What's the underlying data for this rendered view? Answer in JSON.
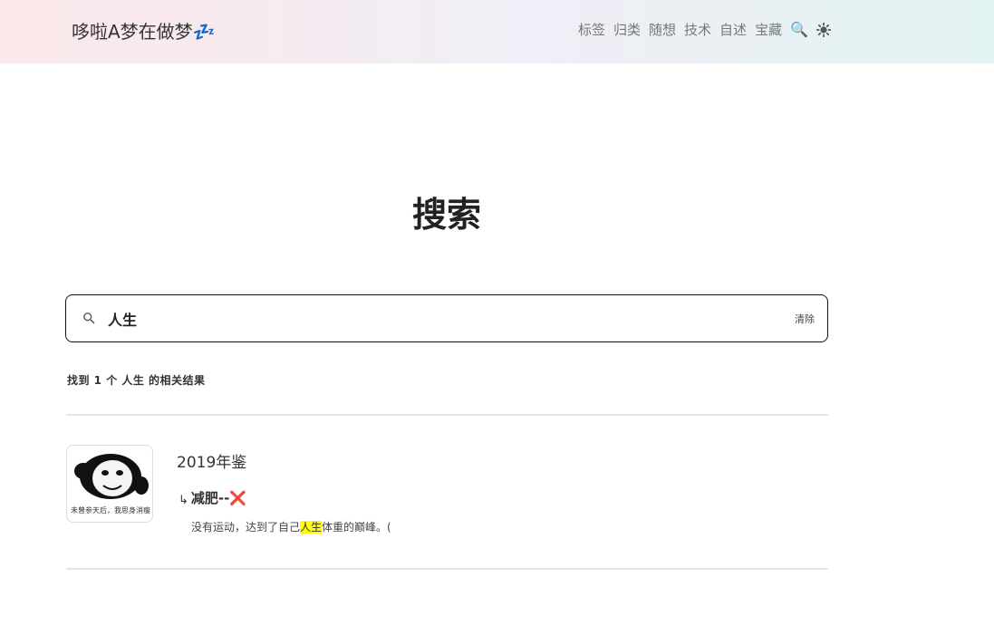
{
  "header": {
    "site_title": "哆啦A梦在做梦💤",
    "nav": [
      "标签",
      "归类",
      "随想",
      "技术",
      "自述",
      "宝藏"
    ],
    "search_icon": "🔍"
  },
  "page": {
    "title": "搜索"
  },
  "search": {
    "value": "人生",
    "clear_label": "清除"
  },
  "results": {
    "summary": "找到 1 个 人生 的相关结果",
    "items": [
      {
        "title": "2019年鉴",
        "thumbnail_caption": "未曾参天后，我思身消瘦",
        "sub_heading": "减肥--❌",
        "sub_heading_arrow": "↳",
        "snippet_before": "没有运动，达到了自己",
        "snippet_match": "人生",
        "snippet_after": "体重的巅峰。("
      }
    ]
  }
}
